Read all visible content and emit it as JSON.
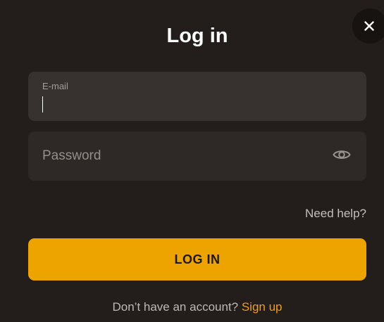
{
  "modal": {
    "title": "Log in",
    "close_icon": "close-icon"
  },
  "email": {
    "label": "E-mail",
    "value": "",
    "placeholder": ""
  },
  "password": {
    "value": "",
    "placeholder": "Password",
    "toggle_icon": "eye-icon"
  },
  "links": {
    "need_help": "Need help?"
  },
  "login_button": {
    "label": "LOG IN"
  },
  "signup": {
    "prompt": "Don’t have an account?",
    "link": "Sign up"
  },
  "colors": {
    "background": "#231e1b",
    "field_active": "#37322f",
    "field": "#2e2926",
    "accent": "#eda300",
    "link_accent": "#f09a2a"
  }
}
